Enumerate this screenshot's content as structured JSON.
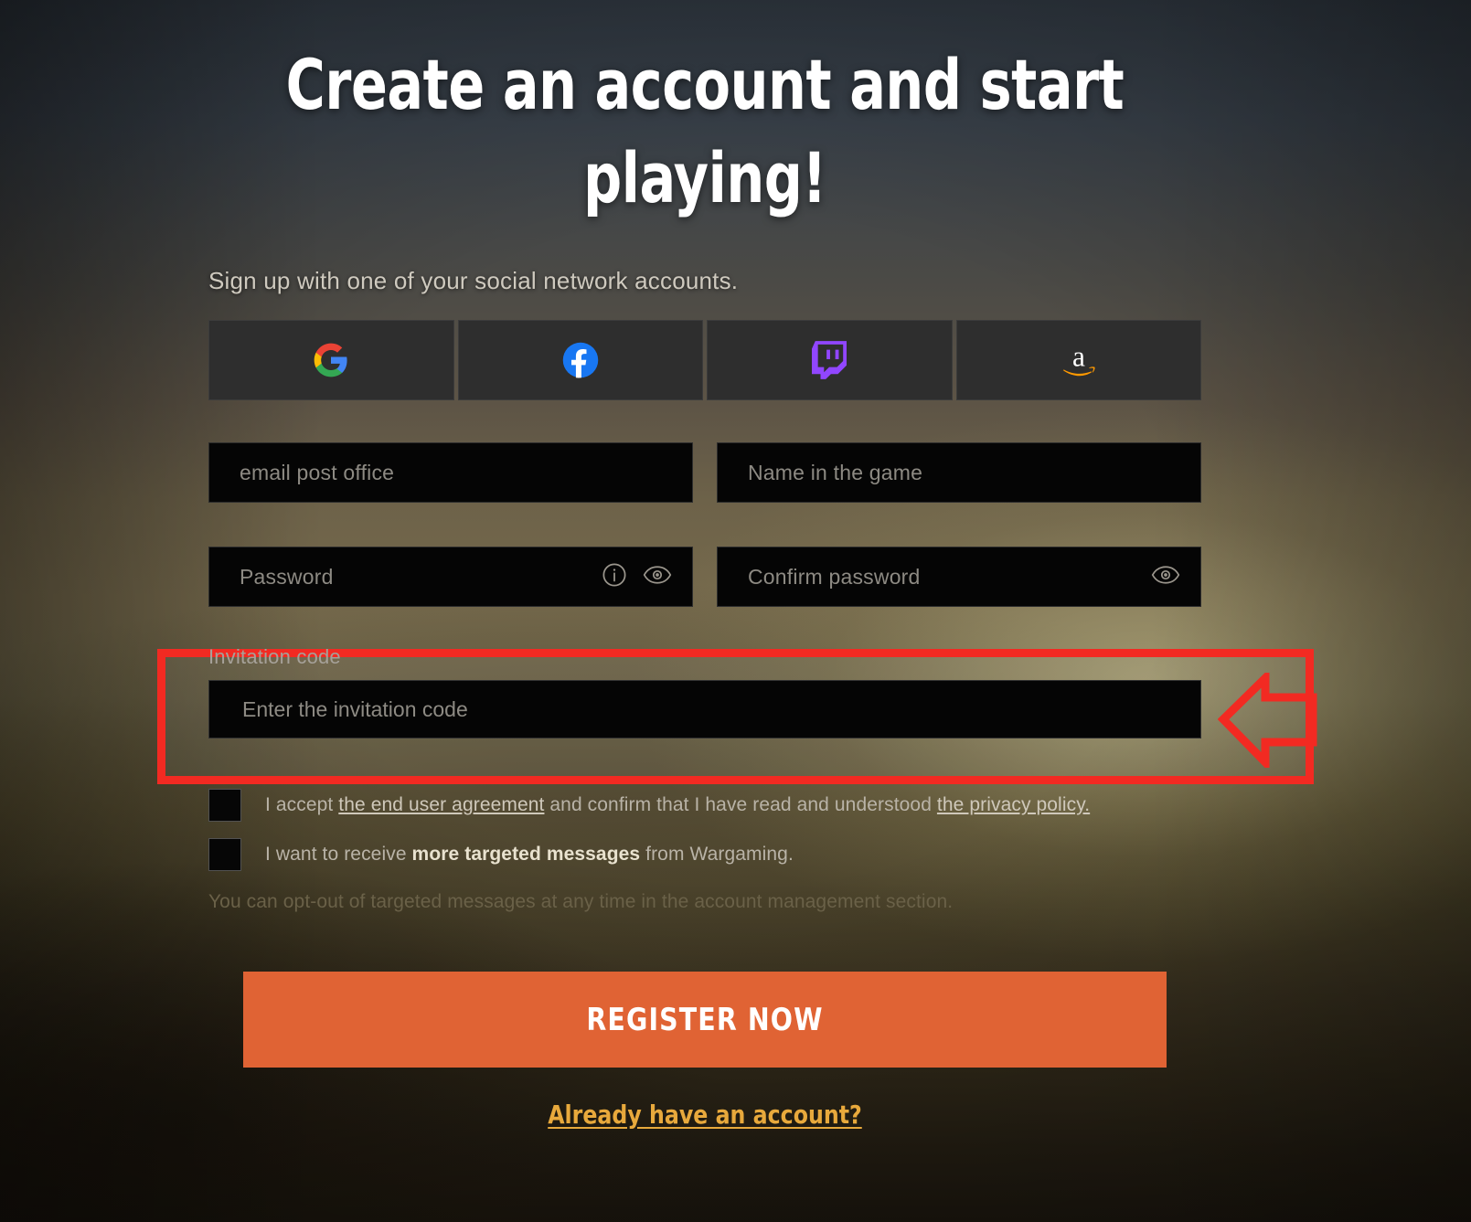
{
  "page": {
    "heading": "Create an account and start playing!",
    "social_prompt": "Sign up with one of your social network accounts."
  },
  "social_buttons": [
    {
      "name": "google",
      "icon": "google-icon"
    },
    {
      "name": "facebook",
      "icon": "facebook-icon"
    },
    {
      "name": "twitch",
      "icon": "twitch-icon"
    },
    {
      "name": "amazon",
      "icon": "amazon-icon"
    }
  ],
  "fields": {
    "email": {
      "placeholder": "email post office",
      "value": ""
    },
    "nickname": {
      "placeholder": "Name in the game",
      "value": ""
    },
    "password": {
      "placeholder": "Password",
      "value": "",
      "icons": [
        "info-icon",
        "eye-icon"
      ]
    },
    "confirm_password": {
      "placeholder": "Confirm password",
      "value": "",
      "icons": [
        "eye-icon"
      ]
    },
    "invitation": {
      "label": "Invitation code",
      "placeholder": "Enter the invitation code",
      "value": ""
    }
  },
  "checkboxes": [
    {
      "checked": false,
      "text_parts": [
        {
          "type": "text",
          "value": "I accept "
        },
        {
          "type": "link",
          "value": "the end user agreement"
        },
        {
          "type": "text",
          "value": " and confirm that I have read and understood "
        },
        {
          "type": "link",
          "value": "the privacy policy."
        }
      ]
    },
    {
      "checked": false,
      "text_parts": [
        {
          "type": "text",
          "value": "I want to receive "
        },
        {
          "type": "bold",
          "value": "more targeted messages"
        },
        {
          "type": "text",
          "value": " from Wargaming."
        }
      ]
    }
  ],
  "optout_note": "You can opt-out of targeted messages at any time in the account management section.",
  "register_button": {
    "label": "REGISTER NOW"
  },
  "footer": {
    "login_link": "Already have an account?"
  },
  "annotation": {
    "type": "highlight-box-with-arrow",
    "target": "invitation-code-field",
    "color": "#f22a22",
    "arrow_direction": "left"
  },
  "colors": {
    "accent_orange": "#e06334",
    "link_gold": "#e8a93c",
    "annotation_red": "#f22a22",
    "field_background": "#050505",
    "social_button_background": "#2e2e2e"
  }
}
